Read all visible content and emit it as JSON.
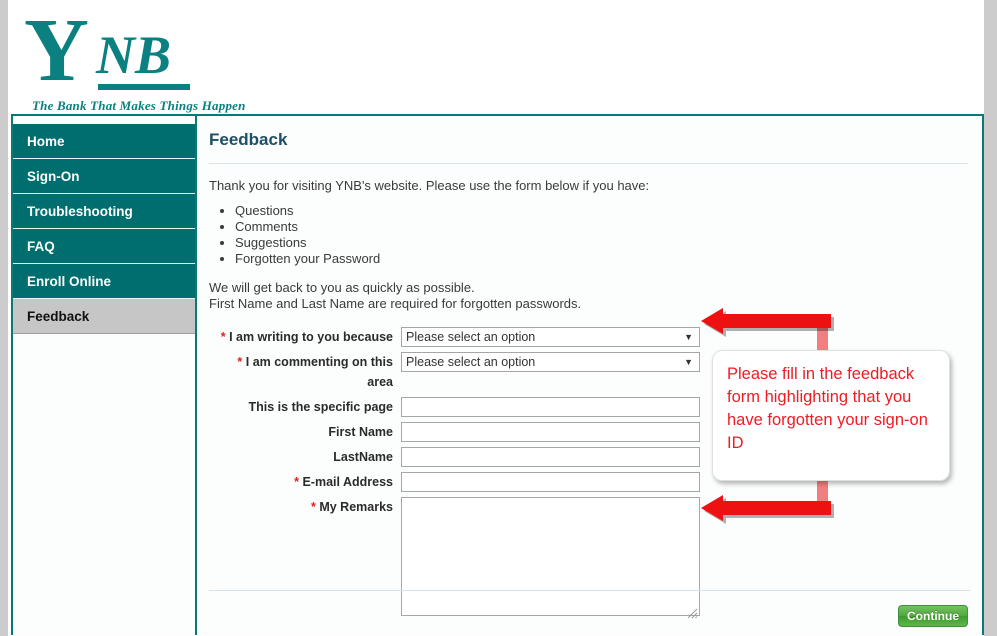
{
  "brand": {
    "logo_letter": "Y",
    "logo_letters": "NB",
    "tagline": "The Bank That Makes Things Happen",
    "brand_color": "#0b8080"
  },
  "sidebar": {
    "items": [
      {
        "label": "Home",
        "active": false
      },
      {
        "label": "Sign-On",
        "active": false
      },
      {
        "label": "Troubleshooting",
        "active": false
      },
      {
        "label": "FAQ",
        "active": false
      },
      {
        "label": "Enroll Online",
        "active": false
      },
      {
        "label": "Feedback",
        "active": true
      }
    ]
  },
  "main": {
    "title": "Feedback",
    "intro": "Thank you for visiting YNB's website. Please use the form below if you have:",
    "reasons": [
      "Questions",
      "Comments",
      "Suggestions",
      "Forgotten your Password"
    ],
    "closing_line1": "We will get back to you as quickly as possible.",
    "closing_line2": "First Name and Last Name are required for forgotten passwords."
  },
  "form": {
    "required_marker": "*",
    "select_placeholder": "Please select an option",
    "dropdown_arrow": "▼",
    "fields": [
      {
        "label": "I am writing to you because",
        "required": true,
        "type": "select",
        "value": "Please select an option"
      },
      {
        "label": "I am commenting on this area",
        "required": true,
        "type": "select",
        "value": "Please select an option"
      },
      {
        "label": "This is the specific page",
        "required": false,
        "type": "text",
        "value": ""
      },
      {
        "label": "First Name",
        "required": false,
        "type": "text",
        "value": ""
      },
      {
        "label": "LastName",
        "required": false,
        "type": "text",
        "value": ""
      },
      {
        "label": "E-mail Address",
        "required": true,
        "type": "text",
        "value": ""
      },
      {
        "label": "My Remarks",
        "required": true,
        "type": "textarea",
        "value": ""
      }
    ]
  },
  "footer": {
    "continue_label": "Continue"
  },
  "annotation": {
    "callout_text": "Please fill in the feedback form highlighting that you have forgotten your sign-on ID",
    "callout_color": "#ef1c24",
    "arrow_color": "#ee1111"
  }
}
